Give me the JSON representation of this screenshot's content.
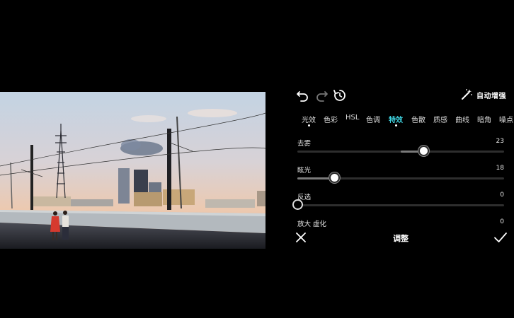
{
  "app": {
    "accent_color": "#3ed3e0",
    "background_color": "#000000"
  },
  "preview": {
    "image": "sunset city street with power line tower and two people walking"
  },
  "toolbar": {
    "undo_icon": "undo-icon",
    "redo_icon": "redo-icon",
    "reset_icon": "reset-icon",
    "auto_enhance_icon": "magic-wand-icon",
    "auto_enhance_label": "自动增强"
  },
  "tabs": [
    {
      "label": "光效",
      "active": false,
      "dot": true
    },
    {
      "label": "色彩",
      "active": false,
      "dot": false
    },
    {
      "label": "HSL",
      "active": false,
      "dot": false
    },
    {
      "label": "色调",
      "active": false,
      "dot": false
    },
    {
      "label": "特效",
      "active": true,
      "dot": true
    },
    {
      "label": "色散",
      "active": false,
      "dot": false
    },
    {
      "label": "质感",
      "active": false,
      "dot": false
    },
    {
      "label": "曲线",
      "active": false,
      "dot": false
    },
    {
      "label": "暗角",
      "active": false,
      "dot": false
    },
    {
      "label": "噪点",
      "active": false,
      "dot": false
    }
  ],
  "sliders": [
    {
      "label": "去雾",
      "value": "23",
      "level": 0.61,
      "bipolar": true
    },
    {
      "label": "眩光",
      "value": "18",
      "level": 0.18,
      "bipolar": false
    },
    {
      "label": "反选",
      "value": "0",
      "level": 0.0,
      "bipolar": false
    },
    {
      "label": "放大 虚化",
      "value": "0",
      "level": 0.0,
      "bipolar": false
    }
  ],
  "bottom": {
    "title": "调整",
    "cancel_icon": "close-icon",
    "confirm_icon": "check-icon"
  }
}
